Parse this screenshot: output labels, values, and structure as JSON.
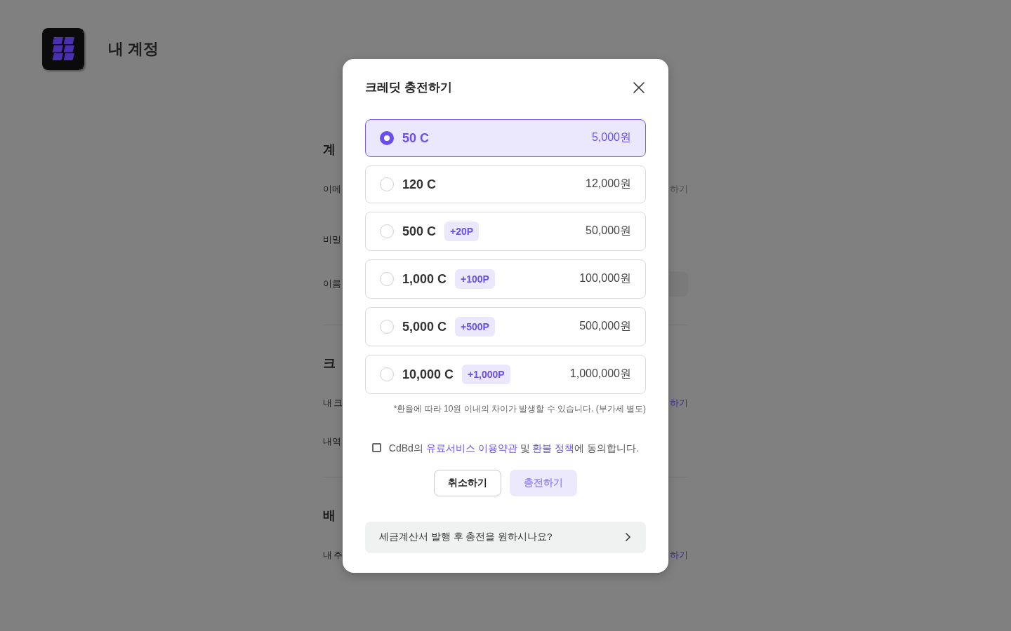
{
  "header": {
    "title": "내 계정"
  },
  "page": {
    "sections": [
      {
        "title": "계",
        "rows": [
          {
            "kind": "text",
            "label": "이메",
            "action": {
              "text": "하기",
              "kind": "muted"
            }
          },
          {
            "kind": "text",
            "label": "비밀"
          },
          {
            "kind": "field",
            "label": "이름"
          }
        ]
      },
      {
        "title": "크",
        "rows": [
          {
            "kind": "text",
            "label": "내 크",
            "action": {
              "text": "하기",
              "kind": "link"
            }
          },
          {
            "kind": "text",
            "label": "내역"
          }
        ]
      },
      {
        "title": "배",
        "rows": [
          {
            "kind": "text",
            "label": "내 주",
            "action": {
              "text": "하기",
              "kind": "link"
            }
          }
        ]
      }
    ]
  },
  "dialog": {
    "title": "크레딧 충전하기",
    "options": [
      {
        "amount": "50 C",
        "price": "5,000원",
        "selected": true
      },
      {
        "amount": "120 C",
        "price": "12,000원",
        "selected": false
      },
      {
        "amount": "500 C",
        "bonus": "+20P",
        "price": "50,000원",
        "selected": false
      },
      {
        "amount": "1,000 C",
        "bonus": "+100P",
        "price": "100,000원",
        "selected": false
      },
      {
        "amount": "5,000 C",
        "bonus": "+500P",
        "price": "500,000원",
        "selected": false
      },
      {
        "amount": "10,000 C",
        "bonus": "+1,000P",
        "price": "1,000,000원",
        "selected": false
      }
    ],
    "note": "*환율에 따라 10원 이내의 차이가 발생할 수 있습니다. (부가세 별도)",
    "agreement": {
      "checked": false,
      "parts": [
        {
          "kind": "text",
          "text": "CdBd의 "
        },
        {
          "kind": "link",
          "text": "유료서비스 이용약관"
        },
        {
          "kind": "text",
          "text": " 및 "
        },
        {
          "kind": "link",
          "text": "환불 정책"
        },
        {
          "kind": "text",
          "text": "에 동의합니다."
        }
      ]
    },
    "buttons": [
      {
        "kind": "secondary",
        "label": "취소하기",
        "disabled": false
      },
      {
        "kind": "primary",
        "label": "충전하기",
        "disabled": true
      }
    ],
    "tax_invoice": {
      "label": "세금계산서 발행 후 충전을 원하시나요?"
    }
  }
}
